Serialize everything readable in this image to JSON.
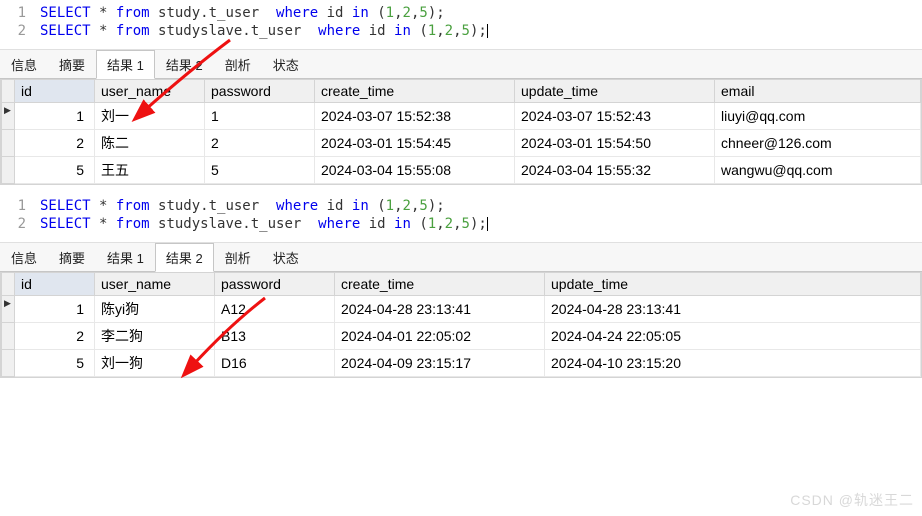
{
  "block1": {
    "code_lines": [
      {
        "n": "1",
        "tokens": [
          [
            "kw",
            "SELECT"
          ],
          [
            "punct",
            " * "
          ],
          [
            "kw",
            "from"
          ],
          [
            "ident",
            " study.t_user  "
          ],
          [
            "kw",
            "where"
          ],
          [
            "ident",
            " id "
          ],
          [
            "kw",
            "in"
          ],
          [
            "punct",
            " ("
          ],
          [
            "num",
            "1"
          ],
          [
            "punct",
            ","
          ],
          [
            "num",
            "2"
          ],
          [
            "punct",
            ","
          ],
          [
            "num",
            "5"
          ],
          [
            "punct",
            ");"
          ]
        ]
      },
      {
        "n": "2",
        "tokens": [
          [
            "kw",
            "SELECT"
          ],
          [
            "punct",
            " * "
          ],
          [
            "kw",
            "from"
          ],
          [
            "ident",
            " studyslave.t_user  "
          ],
          [
            "kw",
            "where"
          ],
          [
            "ident",
            " id "
          ],
          [
            "kw",
            "in"
          ],
          [
            "punct",
            " ("
          ],
          [
            "num",
            "1"
          ],
          [
            "punct",
            ","
          ],
          [
            "num",
            "2"
          ],
          [
            "punct",
            ","
          ],
          [
            "num",
            "5"
          ],
          [
            "punct",
            ");"
          ]
        ]
      }
    ],
    "tabs": {
      "info": "信息",
      "summary": "摘要",
      "result1": "结果 1",
      "result2": "结果 2",
      "profile": "剖析",
      "status": "状态"
    },
    "active_tab": "result1",
    "columns": [
      "id",
      "user_name",
      "password",
      "create_time",
      "update_time",
      "email"
    ],
    "rows": [
      {
        "id": "1",
        "user_name": "刘一",
        "password": "1",
        "create_time": "2024-03-07 15:52:38",
        "update_time": "2024-03-07 15:52:43",
        "email": "liuyi@qq.com"
      },
      {
        "id": "2",
        "user_name": "陈二",
        "password": "2",
        "create_time": "2024-03-01 15:54:45",
        "update_time": "2024-03-01 15:54:50",
        "email": "chneer@126.com"
      },
      {
        "id": "5",
        "user_name": "王五",
        "password": "5",
        "create_time": "2024-03-04 15:55:08",
        "update_time": "2024-03-04 15:55:32",
        "email": "wangwu@qq.com"
      }
    ]
  },
  "block2": {
    "code_lines": [
      {
        "n": "1",
        "tokens": [
          [
            "kw",
            "SELECT"
          ],
          [
            "punct",
            " * "
          ],
          [
            "kw",
            "from"
          ],
          [
            "ident",
            " study.t_user  "
          ],
          [
            "kw",
            "where"
          ],
          [
            "ident",
            " id "
          ],
          [
            "kw",
            "in"
          ],
          [
            "punct",
            " ("
          ],
          [
            "num",
            "1"
          ],
          [
            "punct",
            ","
          ],
          [
            "num",
            "2"
          ],
          [
            "punct",
            ","
          ],
          [
            "num",
            "5"
          ],
          [
            "punct",
            ");"
          ]
        ]
      },
      {
        "n": "2",
        "tokens": [
          [
            "kw",
            "SELECT"
          ],
          [
            "punct",
            " * "
          ],
          [
            "kw",
            "from"
          ],
          [
            "ident",
            " studyslave.t_user  "
          ],
          [
            "kw",
            "where"
          ],
          [
            "ident",
            " id "
          ],
          [
            "kw",
            "in"
          ],
          [
            "punct",
            " ("
          ],
          [
            "num",
            "1"
          ],
          [
            "punct",
            ","
          ],
          [
            "num",
            "2"
          ],
          [
            "punct",
            ","
          ],
          [
            "num",
            "5"
          ],
          [
            "punct",
            ");"
          ]
        ]
      }
    ],
    "tabs": {
      "info": "信息",
      "summary": "摘要",
      "result1": "结果 1",
      "result2": "结果 2",
      "profile": "剖析",
      "status": "状态"
    },
    "active_tab": "result2",
    "columns": [
      "id",
      "user_name",
      "password",
      "create_time",
      "update_time"
    ],
    "rows": [
      {
        "id": "1",
        "user_name": "陈yi狗",
        "password": "A12",
        "create_time": "2024-04-28 23:13:41",
        "update_time": "2024-04-28 23:13:41"
      },
      {
        "id": "2",
        "user_name": "李二狗",
        "password": "B13",
        "create_time": "2024-04-01 22:05:02",
        "update_time": "2024-04-24 22:05:05"
      },
      {
        "id": "5",
        "user_name": "刘一狗",
        "password": "D16",
        "create_time": "2024-04-09 23:15:17",
        "update_time": "2024-04-10 23:15:20"
      }
    ]
  },
  "watermark": "CSDN @轨迷王二"
}
